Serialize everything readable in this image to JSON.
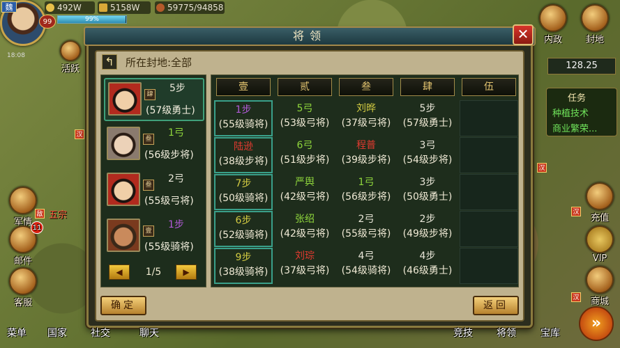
{
  "hud": {
    "nation": "魏",
    "level": "99",
    "time": "18:08",
    "gold": "492W",
    "food": "5158W",
    "troops": "59775/94858",
    "exp_text": "99%",
    "exp_fraction": 0.99
  },
  "left_menu": {
    "activity": "活跃",
    "military": "军情",
    "enemy_flag": "敌",
    "military_sub": "五宗",
    "mail": "邮件",
    "mail_badge": "11",
    "service": "客服"
  },
  "right_menu": {
    "internal": "内政",
    "fief": "封地",
    "recharge_flag": "汉",
    "recharge": "充值",
    "vip": "VIP",
    "shop_flag": "汉",
    "shop": "商城",
    "coords": "128.25"
  },
  "tasks": {
    "title": "任务",
    "items": [
      "种植技术",
      "商业繁荣..."
    ]
  },
  "dialog": {
    "title": "将领",
    "close": "✕",
    "location": "所在封地:全部",
    "ok": "确定",
    "return": "返回"
  },
  "generals": [
    {
      "tag": "肆",
      "name": "5步",
      "name_color": "white",
      "info": "(57级勇士)",
      "portrait": "port-a",
      "selected": true
    },
    {
      "tag": "叁",
      "name": "1弓",
      "name_color": "green",
      "info": "(56级步将)",
      "portrait": "port-b",
      "selected": false
    },
    {
      "tag": "叁",
      "name": "2弓",
      "name_color": "white",
      "info": "(55级弓将)",
      "portrait": "port-a",
      "selected": false
    },
    {
      "tag": "壹",
      "name": "1步",
      "name_color": "purple",
      "info": "(55级骑将)",
      "portrait": "port-c",
      "selected": false
    }
  ],
  "pager": {
    "prev": "◀",
    "text": "1/5",
    "next": "▶"
  },
  "grid": {
    "columns": [
      "壹",
      "贰",
      "叁",
      "肆",
      "伍"
    ],
    "rows": [
      [
        {
          "name": "1步",
          "color": "purple",
          "info": "(55级骑将)",
          "sel": true
        },
        {
          "name": "5弓",
          "color": "green",
          "info": "(53级弓将)"
        },
        {
          "name": "刘晔",
          "color": "yellow",
          "info": "(37级弓将)"
        },
        {
          "name": "5步",
          "color": "white",
          "info": "(57级勇士)"
        },
        null
      ],
      [
        {
          "name": "陆逊",
          "color": "red",
          "info": "(38级步将)",
          "sel": true
        },
        {
          "name": "6弓",
          "color": "green",
          "info": "(51级步将)"
        },
        {
          "name": "程普",
          "color": "red",
          "info": "(39级步将)"
        },
        {
          "name": "3弓",
          "color": "white",
          "info": "(54级步将)"
        },
        null
      ],
      [
        {
          "name": "7步",
          "color": "yellow",
          "info": "(50级骑将)",
          "sel": true
        },
        {
          "name": "严舆",
          "color": "green",
          "info": "(42级弓将)"
        },
        {
          "name": "1弓",
          "color": "green",
          "info": "(56级步将)"
        },
        {
          "name": "3步",
          "color": "white",
          "info": "(50级勇士)"
        },
        null
      ],
      [
        {
          "name": "6步",
          "color": "yellow",
          "info": "(52级骑将)",
          "sel": true
        },
        {
          "name": "张绍",
          "color": "green",
          "info": "(42级弓将)"
        },
        {
          "name": "2弓",
          "color": "white",
          "info": "(55级弓将)"
        },
        {
          "name": "2步",
          "color": "white",
          "info": "(49级步将)"
        },
        null
      ],
      [
        {
          "name": "9步",
          "color": "yellow",
          "info": "(38级骑将)",
          "sel": true
        },
        {
          "name": "刘琮",
          "color": "red",
          "info": "(37级弓将)"
        },
        {
          "name": "4弓",
          "color": "white",
          "info": "(54级骑将)"
        },
        {
          "name": "4步",
          "color": "white",
          "info": "(46级勇士)"
        },
        null
      ]
    ]
  },
  "bottom": {
    "menu": "菜单",
    "country": "国家",
    "social": "社交",
    "chat": "聊天",
    "arena": "竞技",
    "generals": "将领",
    "treasury": "宝库"
  },
  "map_flags": [
    "汉",
    "汉"
  ]
}
